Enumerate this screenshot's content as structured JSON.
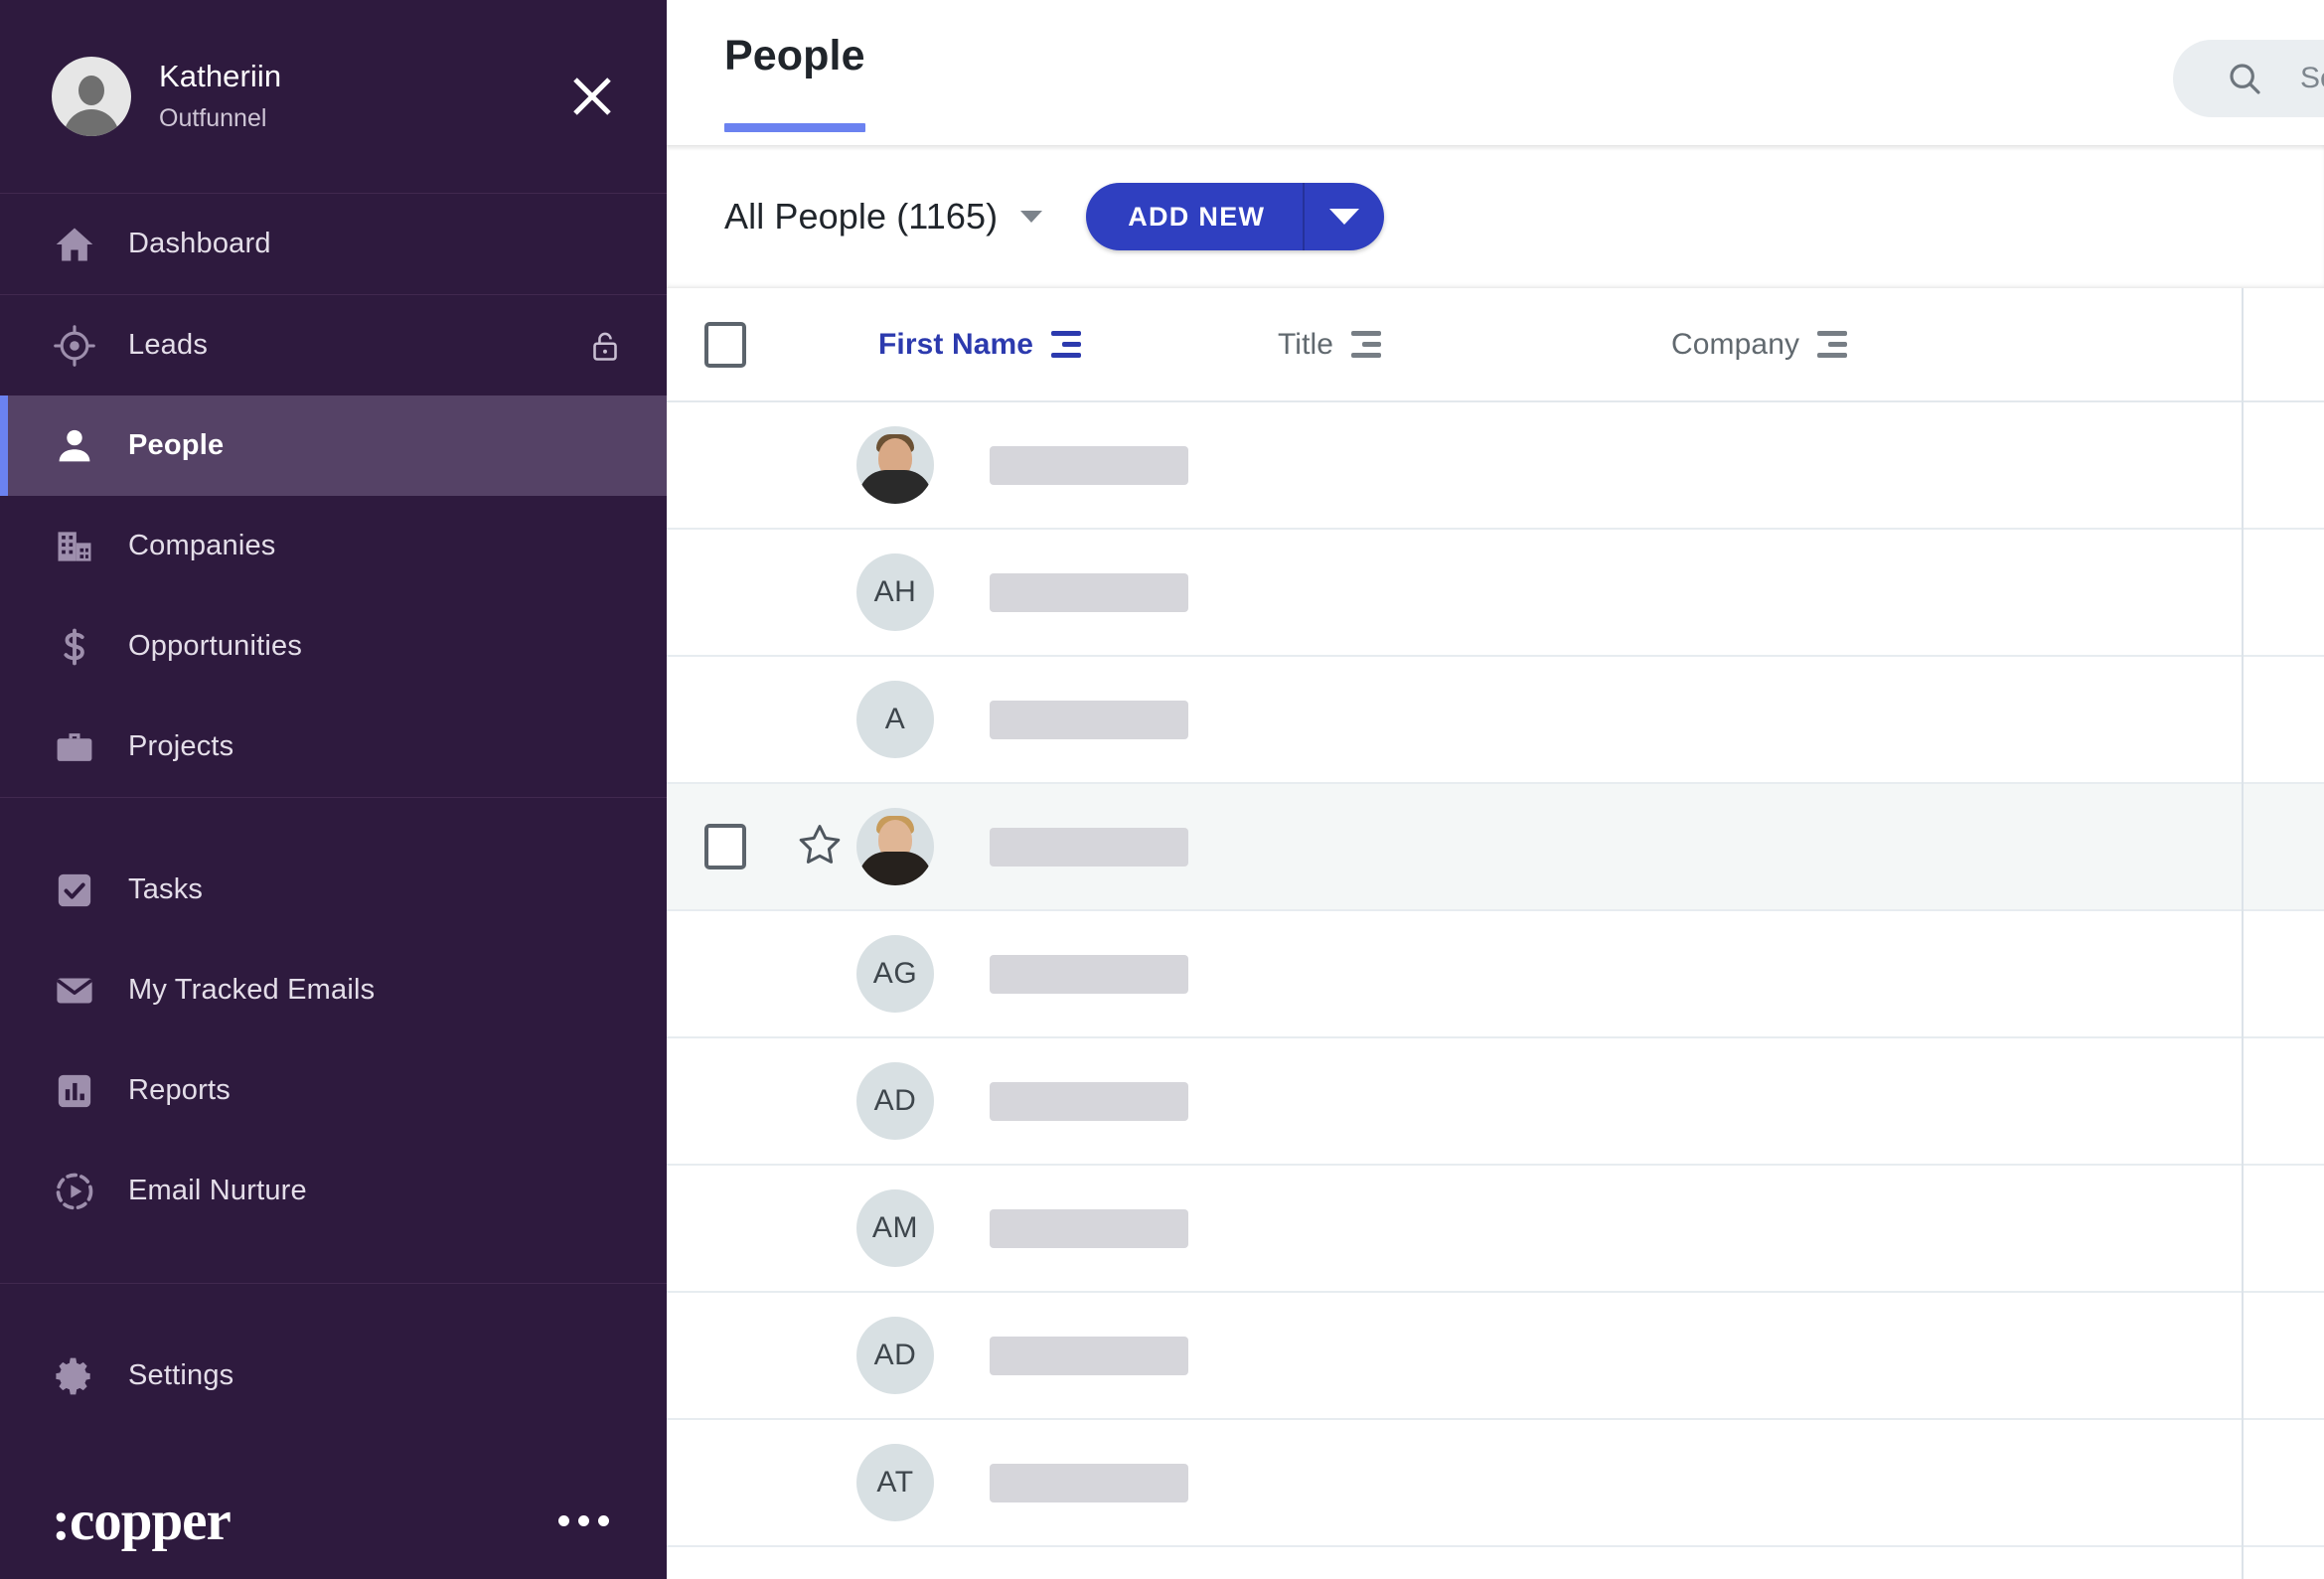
{
  "sidebar": {
    "user": {
      "name": "Katheriin",
      "organization": "Outfunnel",
      "avatar_icon": "default-user-avatar"
    },
    "close_icon": "close-icon",
    "items": [
      {
        "label": "Dashboard",
        "icon": "home-icon",
        "active": false,
        "locked": false
      },
      {
        "label": "Leads",
        "icon": "target-icon",
        "active": false,
        "locked": true
      },
      {
        "label": "People",
        "icon": "person-icon",
        "active": true,
        "locked": false
      },
      {
        "label": "Companies",
        "icon": "building-icon",
        "active": false,
        "locked": false
      },
      {
        "label": "Opportunities",
        "icon": "dollar-icon",
        "active": false,
        "locked": false
      },
      {
        "label": "Projects",
        "icon": "briefcase-icon",
        "active": false,
        "locked": false
      },
      {
        "label": "Tasks",
        "icon": "checkbox-check-icon",
        "active": false,
        "locked": false
      },
      {
        "label": "My Tracked Emails",
        "icon": "envelope-icon",
        "active": false,
        "locked": false
      },
      {
        "label": "Reports",
        "icon": "bar-chart-icon",
        "active": false,
        "locked": false
      },
      {
        "label": "Email Nurture",
        "icon": "play-circle-dashed-icon",
        "active": false,
        "locked": false
      },
      {
        "label": "Settings",
        "icon": "gear-icon",
        "active": false,
        "locked": false
      }
    ],
    "brand": ":copper",
    "more_icon": "more-horizontal-icon",
    "colors": {
      "background": "#2E1A3E",
      "active_background": "#554266",
      "accent_bar": "#6B82F0"
    }
  },
  "header": {
    "tab_title": "People",
    "tab_underline_color": "#6B82F0",
    "search": {
      "placeholder": "Search",
      "value": "",
      "icon": "search-icon"
    }
  },
  "toolbar": {
    "view_label": "All People (1165)",
    "view_caret_icon": "chevron-down-icon",
    "add_new_label": "ADD NEW",
    "add_new_caret_icon": "chevron-down-icon",
    "add_new_color": "#2F3FC0"
  },
  "table": {
    "select_all_icon": "checkbox-empty-icon",
    "columns": [
      {
        "label": "First Name",
        "sorted": true,
        "sort_icon": "sort-icon"
      },
      {
        "label": "Title",
        "sorted": false,
        "sort_icon": "sort-icon"
      },
      {
        "label": "Company",
        "sorted": false,
        "sort_icon": "sort-icon"
      }
    ],
    "rows": [
      {
        "avatar_type": "photo",
        "avatar_text": "",
        "name_redacted": true,
        "hovered": false,
        "title": "",
        "company": ""
      },
      {
        "avatar_type": "initials",
        "avatar_text": "AH",
        "name_redacted": true,
        "hovered": false,
        "title": "",
        "company": ""
      },
      {
        "avatar_type": "initials",
        "avatar_text": "A",
        "name_redacted": true,
        "hovered": false,
        "title": "",
        "company": ""
      },
      {
        "avatar_type": "photo2",
        "avatar_text": "",
        "name_redacted": true,
        "hovered": true,
        "title": "",
        "company": ""
      },
      {
        "avatar_type": "initials",
        "avatar_text": "AG",
        "name_redacted": true,
        "hovered": false,
        "title": "",
        "company": ""
      },
      {
        "avatar_type": "initials",
        "avatar_text": "AD",
        "name_redacted": true,
        "hovered": false,
        "title": "",
        "company": ""
      },
      {
        "avatar_type": "initials",
        "avatar_text": "AM",
        "name_redacted": true,
        "hovered": false,
        "title": "",
        "company": ""
      },
      {
        "avatar_type": "initials",
        "avatar_text": "AD",
        "name_redacted": true,
        "hovered": false,
        "title": "",
        "company": ""
      },
      {
        "avatar_type": "initials",
        "avatar_text": "AT",
        "name_redacted": true,
        "hovered": false,
        "title": "",
        "company": ""
      }
    ],
    "row_checkbox_icon": "checkbox-empty-icon",
    "row_star_icon": "star-outline-icon"
  }
}
